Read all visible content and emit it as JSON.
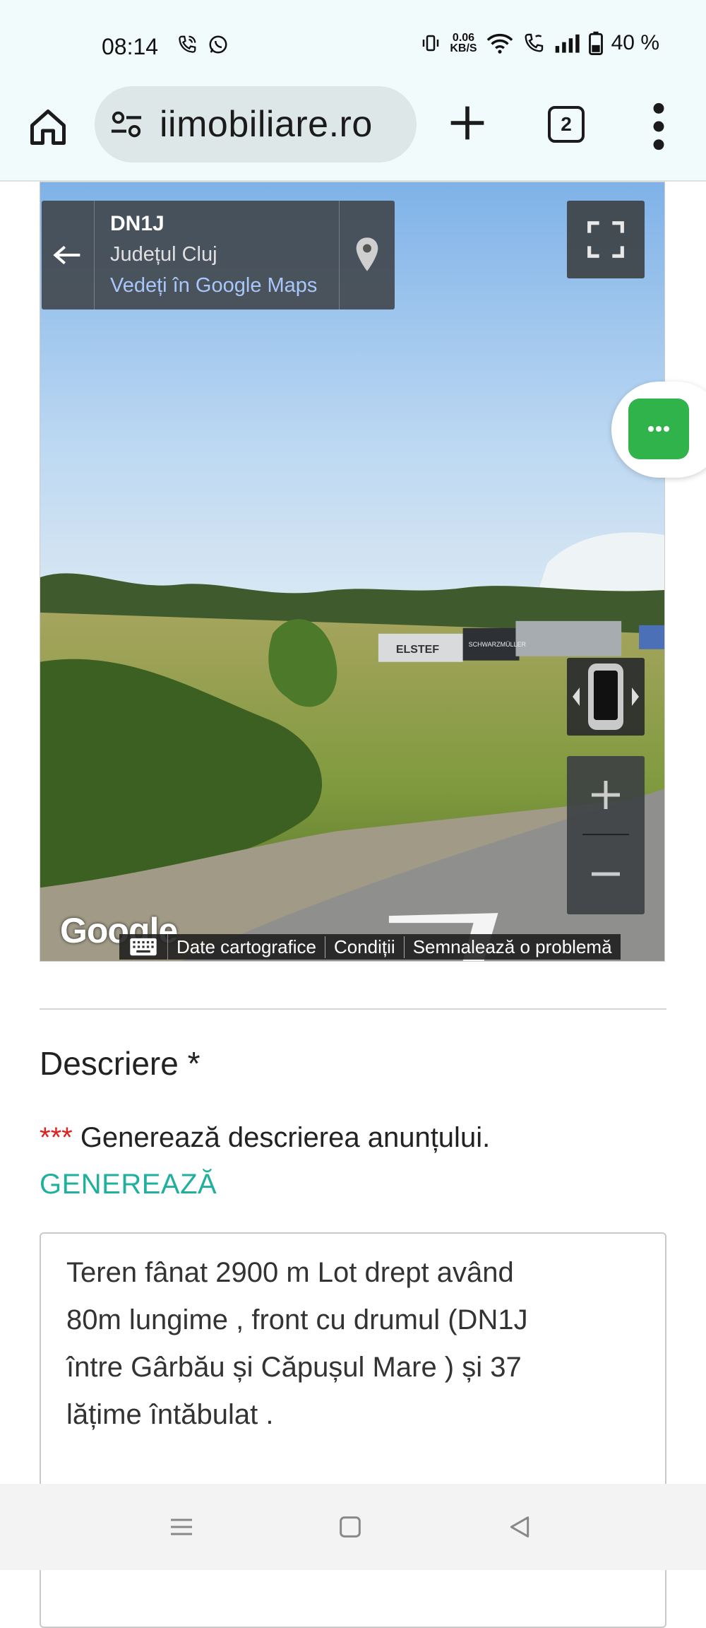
{
  "status_bar": {
    "time": "08:14",
    "net_speed_value": "0.06",
    "net_speed_unit": "KB/S",
    "battery": "40 %",
    "icons": [
      "call-icon",
      "whatsapp-icon",
      "vibrate-icon",
      "wifi-icon",
      "wifi-call-icon",
      "signal-icon",
      "battery-icon"
    ]
  },
  "browser": {
    "url": "iimobiliare.ro",
    "tab_count": "2",
    "icons": [
      "home-icon",
      "site-settings-icon",
      "new-tab-icon",
      "tabs-icon",
      "more-menu-icon"
    ]
  },
  "street_view": {
    "road": "DN1J",
    "county": "Județul Cluj",
    "maps_link": "Vedeți în Google Maps",
    "logo": "Google",
    "attribution": [
      "Date cartografice",
      "Condiții",
      "Semnalează o problemă"
    ],
    "signs": [
      "ELSTEF",
      "SCHWARZMÜLLER"
    ],
    "icons": [
      "back-arrow-icon",
      "map-pin-icon",
      "fullscreen-icon",
      "pegman-rotate-icon",
      "zoom-in-icon",
      "zoom-out-icon",
      "keyboard-icon"
    ]
  },
  "chat": {
    "icon": "chat-dots-icon",
    "color": "#2fb34a"
  },
  "description": {
    "title": "Descriere *",
    "generate_prefix": "***",
    "generate_text": " Generează descrierea anunțului.",
    "generate_link": "GENEREAZĂ",
    "text": "Teren fânat 2900 m  Lot drept având\n80m lungime ,  front cu  drumul (DN1J\nîntre Gârbău și Căpușul Mare ) și  37\nlățime întăbulat ."
  },
  "nav_bar": {
    "icons": [
      "recents-menu-icon",
      "home-square-icon",
      "back-triangle-icon"
    ]
  },
  "colors": {
    "accent": "#1fb19d",
    "required": "#e0201b",
    "chrome_bg": "#f2fbfb"
  }
}
